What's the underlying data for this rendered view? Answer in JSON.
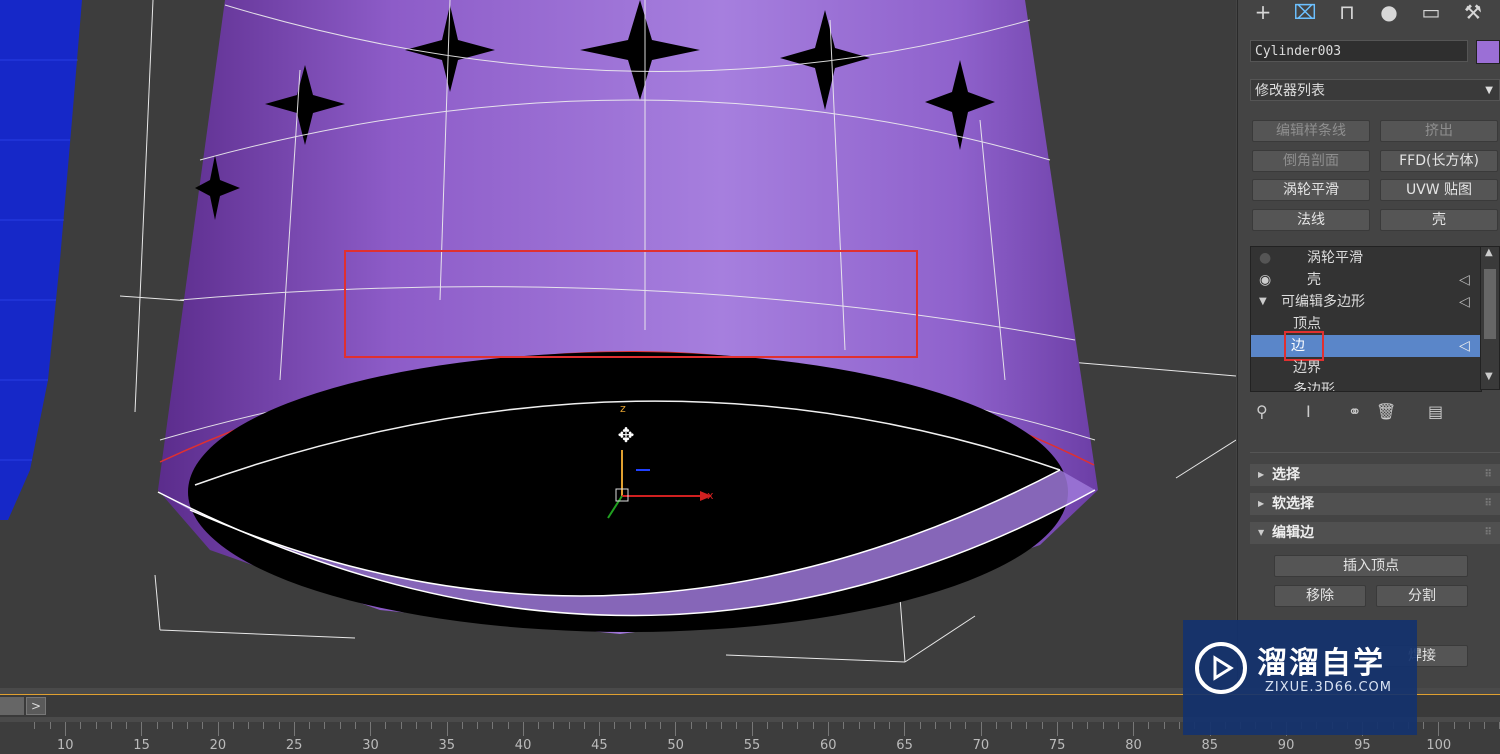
{
  "viewport": {
    "gizmo_z": "z",
    "gizmo_x": "x"
  },
  "command_panel": {
    "tabs": [
      {
        "name": "create",
        "icon": "plus-icon"
      },
      {
        "name": "modify",
        "icon": "modify-icon"
      },
      {
        "name": "hierarchy",
        "icon": "hierarchy-icon"
      },
      {
        "name": "motion",
        "icon": "motion-icon"
      },
      {
        "name": "display",
        "icon": "display-icon"
      },
      {
        "name": "utilities",
        "icon": "wrench-icon"
      }
    ],
    "object_name": "Cylinder003",
    "object_color": "#9b6fd6",
    "modifier_list_label": "修改器列表",
    "modifier_buttons": [
      {
        "label": "编辑样条线",
        "enabled": false
      },
      {
        "label": "挤出",
        "enabled": false
      },
      {
        "label": "倒角剖面",
        "enabled": false
      },
      {
        "label": "FFD(长方体)",
        "enabled": true
      },
      {
        "label": "涡轮平滑",
        "enabled": true
      },
      {
        "label": "UVW 贴图",
        "enabled": true
      },
      {
        "label": "法线",
        "enabled": true
      },
      {
        "label": "壳",
        "enabled": true
      }
    ],
    "stack": [
      {
        "label": "涡轮平滑",
        "type": "modifier"
      },
      {
        "label": "壳",
        "type": "modifier"
      },
      {
        "label": "可编辑多边形",
        "type": "base"
      },
      {
        "label": "顶点",
        "type": "sub"
      },
      {
        "label": "边",
        "type": "sub",
        "selected": true
      },
      {
        "label": "边界",
        "type": "sub"
      },
      {
        "label": "多边形",
        "type": "sub"
      }
    ],
    "rollouts": {
      "select": "选择",
      "soft_select": "软选择",
      "edit_edges": "编辑边",
      "insert_vertex": "插入顶点",
      "remove": "移除",
      "split": "分割",
      "weld": "焊接"
    }
  },
  "timeline": {
    "ticks": [
      10,
      15,
      20,
      25,
      30,
      35,
      40,
      45,
      50,
      55,
      60,
      65,
      70,
      75,
      80,
      85,
      90,
      95,
      100
    ],
    "next_button": ">"
  },
  "watermark": {
    "brand": "溜溜自学",
    "url": "ZIXUE.3D66.COM"
  },
  "accent_colors": {
    "selection": "#5a86c9",
    "highlight_box": "#e03030",
    "object": "#9b6fd6"
  }
}
